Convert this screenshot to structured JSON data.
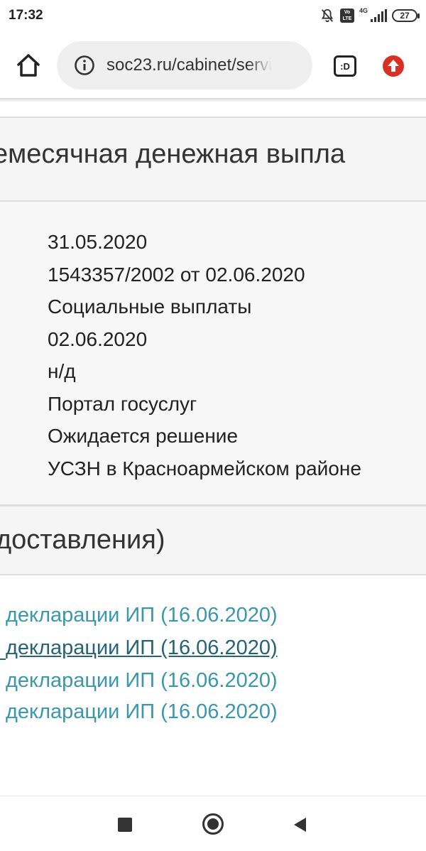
{
  "status_bar": {
    "time": "17:32",
    "network_label": "4G",
    "volte_label": "Vo LTE",
    "battery_level": "27"
  },
  "browser": {
    "url": "soc23.ru/cabinet/servi",
    "tabs_label": ":D"
  },
  "panel_1": {
    "header": "емесячная денежная выпла",
    "fields": [
      "31.05.2020",
      "1543357/2002 от 02.06.2020",
      "Социальные выплаты",
      "02.06.2020",
      "н/д",
      "Портал госуслуг",
      "Ожидается решение",
      "УСЗН в Красноармейском районе"
    ]
  },
  "panel_2": {
    "header": "доставления)"
  },
  "links": [
    "декларации ИП (16.06.2020)",
    "декларации ИП (16.06.2020)",
    "декларации ИП (16.06.2020)",
    "декларации ИП (16.06.2020)"
  ],
  "colors": {
    "link": "#3b98ac",
    "link_hover": "#25637a",
    "panel_bg": "#f5f5f5",
    "update_badge": "#d93025"
  },
  "icons": {
    "home": "home-icon",
    "info": "info-icon",
    "update": "update-icon",
    "mute": "bell-off-icon",
    "signal": "signal-icon"
  }
}
